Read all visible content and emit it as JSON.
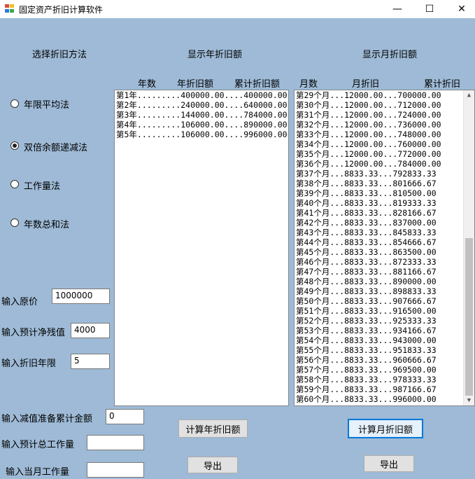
{
  "window": {
    "title": "固定资产折旧计算软件"
  },
  "titlebar_buttons": {
    "minimize": "—",
    "maximize": "☐",
    "close": "✕"
  },
  "headers": {
    "method": "选择折旧方法",
    "yearly": "显示年折旧额",
    "monthly": "显示月折旧额"
  },
  "yearly_columns": {
    "c1": "年数",
    "c2": "年折旧额",
    "c3": "累计折旧额"
  },
  "monthly_columns": {
    "c1": "月数",
    "c2": "月折旧",
    "c3": "累计折旧"
  },
  "methods": [
    {
      "label": "年限平均法",
      "selected": false
    },
    {
      "label": "双倍余额递减法",
      "selected": true
    },
    {
      "label": "工作量法",
      "selected": false
    },
    {
      "label": "年数总和法",
      "selected": false
    }
  ],
  "inputs": {
    "original_label": "输入原价",
    "original_value": "1000000",
    "residual_label": "输入预计净残值",
    "residual_value": "4000",
    "years_label": "输入折旧年限",
    "years_value": "5",
    "impairment_label": "输入减值准备累计金额",
    "impairment_value": "0",
    "total_work_label": "输入预计总工作量",
    "total_work_value": "",
    "month_work_label": "输入当月工作量",
    "month_work_value": ""
  },
  "yearly_rows": [
    "第1年.........400000.00....400000.00",
    "第2年.........240000.00....640000.00",
    "第3年.........144000.00....784000.00",
    "第4年.........106000.00....890000.00",
    "第5年.........106000.00....996000.00"
  ],
  "monthly_rows": [
    "第29个月...12000.00...700000.00",
    "第30个月...12000.00...712000.00",
    "第31个月...12000.00...724000.00",
    "第32个月...12000.00...736000.00",
    "第33个月...12000.00...748000.00",
    "第34个月...12000.00...760000.00",
    "第35个月...12000.00...772000.00",
    "第36个月...12000.00...784000.00",
    "第37个月...8833.33...792833.33",
    "第38个月...8833.33...801666.67",
    "第39个月...8833.33...810500.00",
    "第40个月...8833.33...819333.33",
    "第41个月...8833.33...828166.67",
    "第42个月...8833.33...837000.00",
    "第43个月...8833.33...845833.33",
    "第44个月...8833.33...854666.67",
    "第45个月...8833.33...863500.00",
    "第46个月...8833.33...872333.33",
    "第47个月...8833.33...881166.67",
    "第48个月...8833.33...890000.00",
    "第49个月...8833.33...898833.33",
    "第50个月...8833.33...907666.67",
    "第51个月...8833.33...916500.00",
    "第52个月...8833.33...925333.33",
    "第53个月...8833.33...934166.67",
    "第54个月...8833.33...943000.00",
    "第55个月...8833.33...951833.33",
    "第56个月...8833.33...960666.67",
    "第57个月...8833.33...969500.00",
    "第58个月...8833.33...978333.33",
    "第59个月...8833.33...987166.67",
    "第60个月...8833.33...996000.00"
  ],
  "buttons": {
    "calc_year": "计算年折旧额",
    "calc_month": "计算月折旧额",
    "export_year": "导出",
    "export_month": "导出"
  },
  "scrollbar": {
    "up": "▲",
    "down": "▼"
  }
}
